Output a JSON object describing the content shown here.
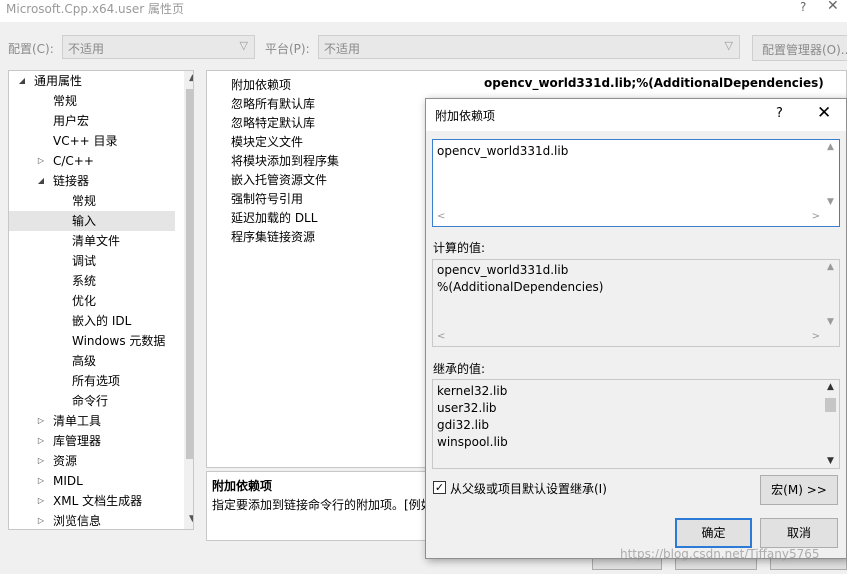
{
  "window": {
    "title": "Microsoft.Cpp.x64.user 属性页",
    "help": "?",
    "close": "✕"
  },
  "config": {
    "config_label": "配置(C):",
    "config_value": "不适用",
    "platform_label": "平台(P):",
    "platform_value": "不适用",
    "manager_button": "配置管理器(O)..."
  },
  "tree": {
    "items": [
      {
        "label": "通用属性",
        "twisty": "◢"
      },
      {
        "label": "常规"
      },
      {
        "label": "用户宏"
      },
      {
        "label": "VC++ 目录"
      },
      {
        "label": "C/C++",
        "twisty": "▷"
      },
      {
        "label": "链接器",
        "twisty": "◢"
      },
      {
        "label": "常规"
      },
      {
        "label": "输入"
      },
      {
        "label": "清单文件"
      },
      {
        "label": "调试"
      },
      {
        "label": "系统"
      },
      {
        "label": "优化"
      },
      {
        "label": "嵌入的 IDL"
      },
      {
        "label": "Windows 元数据"
      },
      {
        "label": "高级"
      },
      {
        "label": "所有选项"
      },
      {
        "label": "命令行"
      },
      {
        "label": "清单工具",
        "twisty": "▷"
      },
      {
        "label": "库管理器",
        "twisty": "▷"
      },
      {
        "label": "资源",
        "twisty": "▷"
      },
      {
        "label": "MIDL",
        "twisty": "▷"
      },
      {
        "label": "XML 文档生成器",
        "twisty": "▷"
      },
      {
        "label": "浏览信息",
        "twisty": "▷"
      }
    ],
    "scroll_up": "▲",
    "scroll_down": "▼"
  },
  "grid": {
    "rows": [
      {
        "name": "附加依赖项",
        "value": "opencv_world331d.lib;%(AdditionalDependencies)"
      },
      {
        "name": "忽略所有默认库",
        "value": ""
      },
      {
        "name": "忽略特定默认库",
        "value": ""
      },
      {
        "name": "模块定义文件",
        "value": ""
      },
      {
        "name": "将模块添加到程序集",
        "value": ""
      },
      {
        "name": "嵌入托管资源文件",
        "value": ""
      },
      {
        "name": "强制符号引用",
        "value": ""
      },
      {
        "name": "延迟加载的 DLL",
        "value": ""
      },
      {
        "name": "程序集链接资源",
        "value": ""
      }
    ]
  },
  "description": {
    "title": "附加依赖项",
    "text": "指定要添加到链接命令行的附加项。[例如"
  },
  "dialog": {
    "title": "附加依赖项",
    "help": "?",
    "close": "✕",
    "input_value": "opencv_world331d.lib",
    "computed_label": "计算的值:",
    "computed_lines": [
      "opencv_world331d.lib",
      "%(AdditionalDependencies)"
    ],
    "inherited_label": "继承的值:",
    "inherited_lines": [
      "kernel32.lib",
      "user32.lib",
      "gdi32.lib",
      "winspool.lib"
    ],
    "inherit_checkbox": "从父级或项目默认设置继承(I)",
    "inherit_checked": true,
    "macro_button": "宏(M) >>",
    "ok_button": "确定",
    "cancel_button": "取消",
    "arrows": {
      "up": "▲",
      "down": "▼",
      "left": "<",
      "right": ">"
    }
  },
  "watermark": "https://blog.csdn.net/Tiffany5765"
}
